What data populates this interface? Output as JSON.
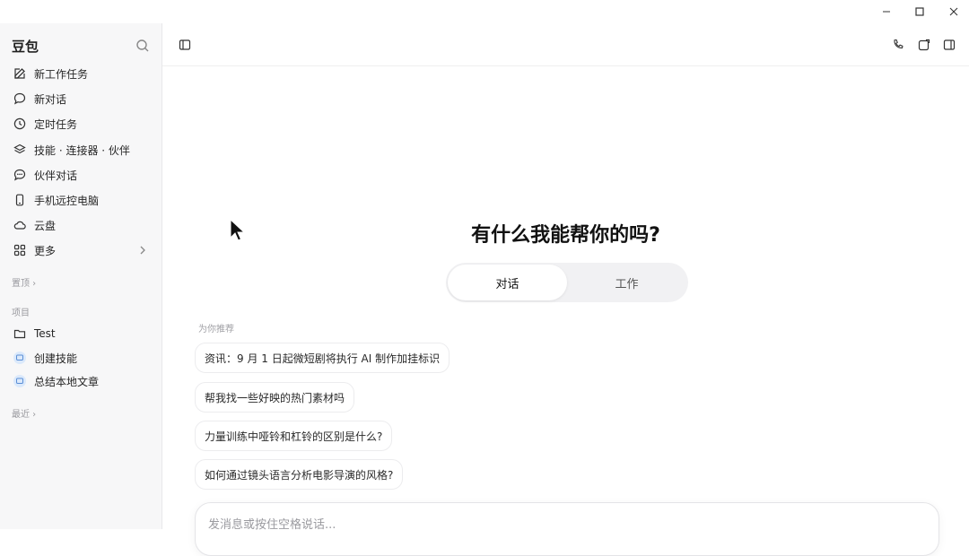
{
  "sidebar": {
    "brand": "豆包",
    "items": [
      {
        "label": "新工作任务",
        "icon": "edit-icon"
      },
      {
        "label": "新对话",
        "icon": "chat-bubble-icon"
      },
      {
        "label": "定时任务",
        "icon": "clock-icon"
      },
      {
        "label": "技能 · 连接器 · 伙伴",
        "icon": "layers-icon"
      },
      {
        "label": "伙伴对话",
        "icon": "chat-dots-icon"
      },
      {
        "label": "手机远控电脑",
        "icon": "phone-icon"
      },
      {
        "label": "云盘",
        "icon": "cloud-icon"
      },
      {
        "label": "更多",
        "icon": "grid-icon"
      }
    ],
    "sections": {
      "pinned": "置顶 ›",
      "projects": "项目",
      "recent": "最近 ›"
    },
    "projects": [
      {
        "label": "Test",
        "icon": "folder-icon"
      },
      {
        "label": "创建技能",
        "icon": "project-avatar-icon"
      },
      {
        "label": "总结本地文章",
        "icon": "project-avatar-icon"
      }
    ]
  },
  "main": {
    "hero_title": "有什么我能帮你的吗?",
    "tabs": [
      {
        "label": "对话",
        "active": true
      },
      {
        "label": "工作",
        "active": false
      }
    ],
    "recommend_label": "为你推荐",
    "suggestions": [
      "资讯：9 月 1 日起微短剧将执行 AI 制作加挂标识",
      "帮我找一些好映的热门素材吗",
      "力量训练中哑铃和杠铃的区别是什么?",
      "如何通过镜头语言分析电影导演的风格?"
    ],
    "composer": {
      "placeholder": "发消息或按住空格说话..."
    }
  },
  "colors": {
    "accent": "#111111",
    "sidebar_bg": "#f7f7f8",
    "muted": "#9a9a9f"
  }
}
